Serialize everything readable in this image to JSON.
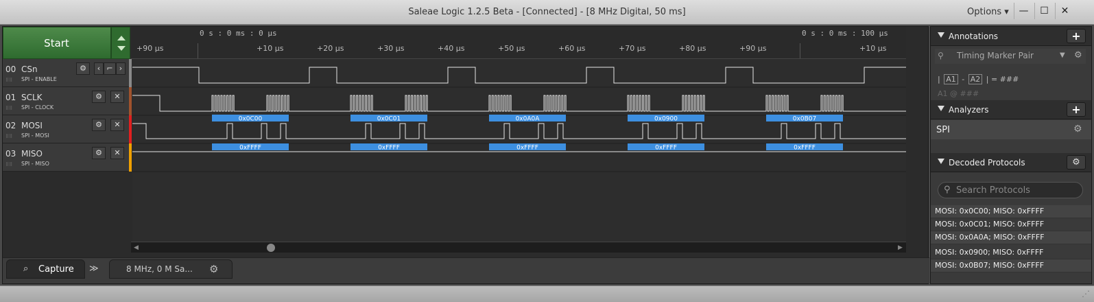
{
  "window": {
    "title": "Saleae Logic 1.2.5 Beta - [Connected] - [8 MHz Digital, 50 ms]",
    "options_label": "Options ▾",
    "minimize": "—",
    "maximize": "☐",
    "close": "✕"
  },
  "start": {
    "label": "Start"
  },
  "ruler": {
    "abs_left": "0 s : 0 ms : 0 μs",
    "abs_right": "0 s : 0 ms : 100 μs",
    "ticks": [
      "+90 μs",
      "+10 μs",
      "+20 μs",
      "+30 μs",
      "+40 μs",
      "+50 μs",
      "+60 μs",
      "+70 μs",
      "+80 μs",
      "+90 μs",
      "+10 μs"
    ]
  },
  "channels": [
    {
      "num": "00",
      "name": "CSn",
      "sub": "SPI - ENABLE",
      "color": "#9a9a9a"
    },
    {
      "num": "01",
      "name": "SCLK",
      "sub": "SPI - CLOCK",
      "color": "#a0522d"
    },
    {
      "num": "02",
      "name": "MOSI",
      "sub": "SPI - MOSI",
      "color": "#e02020"
    },
    {
      "num": "03",
      "name": "MISO",
      "sub": "SPI - MISO",
      "color": "#f0a000"
    }
  ],
  "decoded": {
    "mosi": [
      "0x0C00",
      "0x0C01",
      "0x0A0A",
      "0x0900",
      "0x0B07"
    ],
    "miso": [
      "0xFFFF",
      "0xFFFF",
      "0xFFFF",
      "0xFFFF",
      "0xFFFF"
    ],
    "label_color": "#3d8fe0"
  },
  "bottombar": {
    "capture_tab": "Capture",
    "more": "≫",
    "session_info": "8 MHz, 0 M Sa..."
  },
  "annotations": {
    "header": "Annotations",
    "marker_pair": "Timing Marker Pair",
    "formula_pre": "|",
    "a1": "A1",
    "minus": "-",
    "a2": "A2",
    "formula_post": "| = ###",
    "marker_line": "A1  @  ###"
  },
  "analyzers": {
    "header": "Analyzers",
    "items": [
      "SPI"
    ]
  },
  "protocols": {
    "header": "Decoded Protocols",
    "search_placeholder": "Search Protocols",
    "rows": [
      "MOSI: 0x0C00;  MISO: 0xFFFF",
      "MOSI: 0x0C01;  MISO: 0xFFFF",
      "MOSI: 0x0A0A;  MISO: 0xFFFF",
      "MOSI: 0x0900;  MISO: 0xFFFF",
      "MOSI: 0x0B07;  MISO: 0xFFFF"
    ]
  }
}
